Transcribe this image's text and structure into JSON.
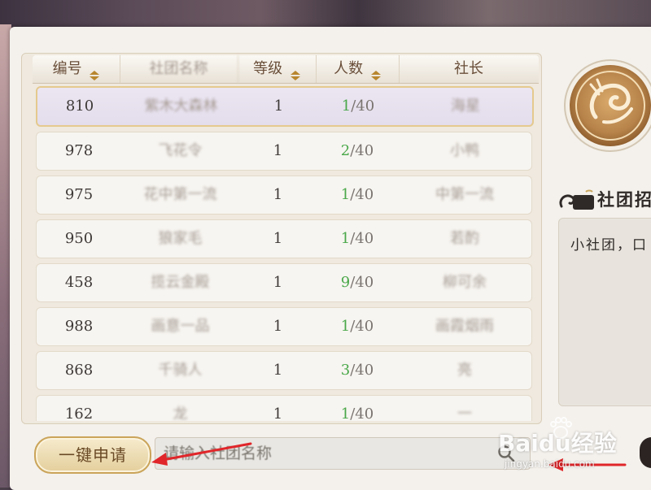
{
  "table": {
    "headers": [
      {
        "label": "编号",
        "sortable": true
      },
      {
        "label": "社团名称",
        "sortable": false
      },
      {
        "label": "等级",
        "sortable": true
      },
      {
        "label": "人数",
        "sortable": true
      },
      {
        "label": "社长",
        "sortable": false
      }
    ],
    "rows": [
      {
        "id": "810",
        "name": "紫木大森林",
        "level": "1",
        "count": "1",
        "max": "/40",
        "leader": "海星",
        "selected": true
      },
      {
        "id": "978",
        "name": "飞花令",
        "level": "1",
        "count": "2",
        "max": "/40",
        "leader": "小鸭"
      },
      {
        "id": "975",
        "name": "花中第一流",
        "level": "1",
        "count": "1",
        "max": "/40",
        "leader": "中第一流"
      },
      {
        "id": "950",
        "name": "狼家毛",
        "level": "1",
        "count": "1",
        "max": "/40",
        "leader": "若酌"
      },
      {
        "id": "458",
        "name": "揽云金殿",
        "level": "1",
        "count": "9",
        "max": "/40",
        "leader": "柳可余"
      },
      {
        "id": "988",
        "name": "画意一品",
        "level": "1",
        "count": "1",
        "max": "/40",
        "leader": "画霞烟雨"
      },
      {
        "id": "868",
        "name": "千骑人",
        "level": "1",
        "count": "3",
        "max": "/40",
        "leader": "亮"
      },
      {
        "id": "162",
        "name": "龙",
        "level": "1",
        "count": "1",
        "max": "/40",
        "leader": "一"
      }
    ]
  },
  "side": {
    "intro_title": "社团招",
    "intro_text": "小社团，口"
  },
  "bottom": {
    "apply_label": "一键申请",
    "search_placeholder": "请输入社团名称"
  },
  "watermark": {
    "main": "Baidu经验",
    "sub": "jingyan.baidu.com"
  },
  "colors": {
    "count_green": "#4aa84a",
    "arrow_red": "#e0262a",
    "gold": "#caa45a"
  }
}
